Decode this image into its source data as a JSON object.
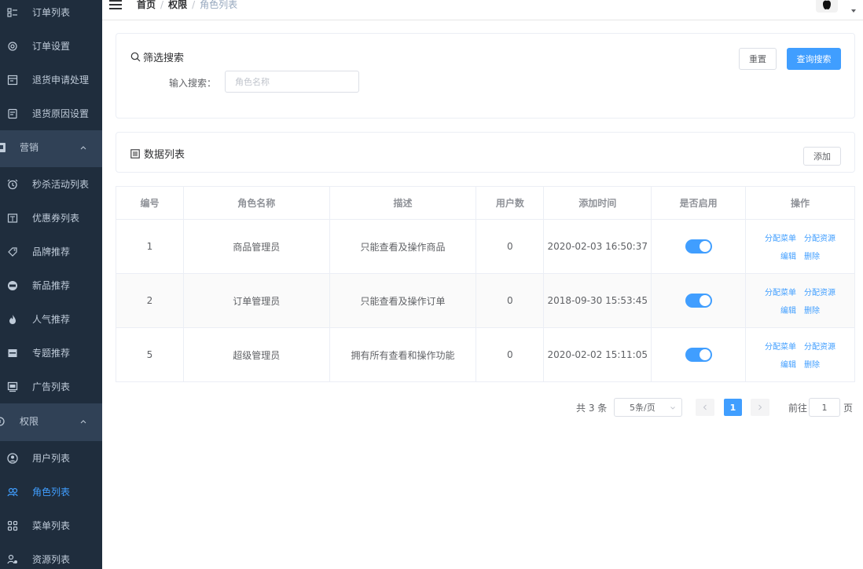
{
  "sidebar": {
    "items": [
      {
        "label": "订单列表",
        "icon": "order-list-icon"
      },
      {
        "label": "订单设置",
        "icon": "order-settings-icon"
      },
      {
        "label": "退货申请处理",
        "icon": "return-apply-icon"
      },
      {
        "label": "退货原因设置",
        "icon": "return-reason-icon"
      }
    ],
    "group_marketing": {
      "label": "营销",
      "icon": "marketing-icon"
    },
    "marketing_items": [
      {
        "label": "秒杀活动列表",
        "icon": "flash-sale-icon"
      },
      {
        "label": "优惠券列表",
        "icon": "coupon-icon"
      },
      {
        "label": "品牌推荐",
        "icon": "brand-icon"
      },
      {
        "label": "新品推荐",
        "icon": "new-product-icon"
      },
      {
        "label": "人气推荐",
        "icon": "hot-icon"
      },
      {
        "label": "专题推荐",
        "icon": "topic-icon"
      },
      {
        "label": "广告列表",
        "icon": "ad-icon"
      }
    ],
    "group_permission": {
      "label": "权限",
      "icon": "permission-icon"
    },
    "permission_items": [
      {
        "label": "用户列表",
        "icon": "user-icon"
      },
      {
        "label": "角色列表",
        "icon": "role-icon",
        "active": true
      },
      {
        "label": "菜单列表",
        "icon": "menu-icon"
      },
      {
        "label": "资源列表",
        "icon": "resource-icon"
      }
    ]
  },
  "header": {
    "breadcrumb": [
      "首页",
      "权限",
      "角色列表"
    ]
  },
  "filter": {
    "title": "筛选搜索",
    "reset_label": "重置",
    "search_label": "查询搜索",
    "input_label": "输入搜索：",
    "input_placeholder": "角色名称",
    "input_value": ""
  },
  "data_list": {
    "title": "数据列表",
    "add_label": "添加"
  },
  "table": {
    "columns": [
      "编号",
      "角色名称",
      "描述",
      "用户数",
      "添加时间",
      "是否启用",
      "操作"
    ],
    "rows": [
      {
        "id": "1",
        "name": "商品管理员",
        "desc": "只能查看及操作商品",
        "users": "0",
        "time": "2020-02-03 16:50:37",
        "enabled": true
      },
      {
        "id": "2",
        "name": "订单管理员",
        "desc": "只能查看及操作订单",
        "users": "0",
        "time": "2018-09-30 15:53:45",
        "enabled": true
      },
      {
        "id": "5",
        "name": "超级管理员",
        "desc": "拥有所有查看和操作功能",
        "users": "0",
        "time": "2020-02-02 15:11:05",
        "enabled": true
      }
    ],
    "actions": {
      "assign_menu": "分配菜单",
      "assign_resource": "分配资源",
      "edit": "编辑",
      "delete": "删除"
    }
  },
  "pagination": {
    "total": "共 3 条",
    "page_size": "5条/页",
    "current_page": "1",
    "goto_label": "前往",
    "goto_value": "1",
    "page_label": "页"
  },
  "colors": {
    "sidebar_bg": "#304156",
    "submenu_bg": "#1f2d3d",
    "accent": "#409eff"
  }
}
